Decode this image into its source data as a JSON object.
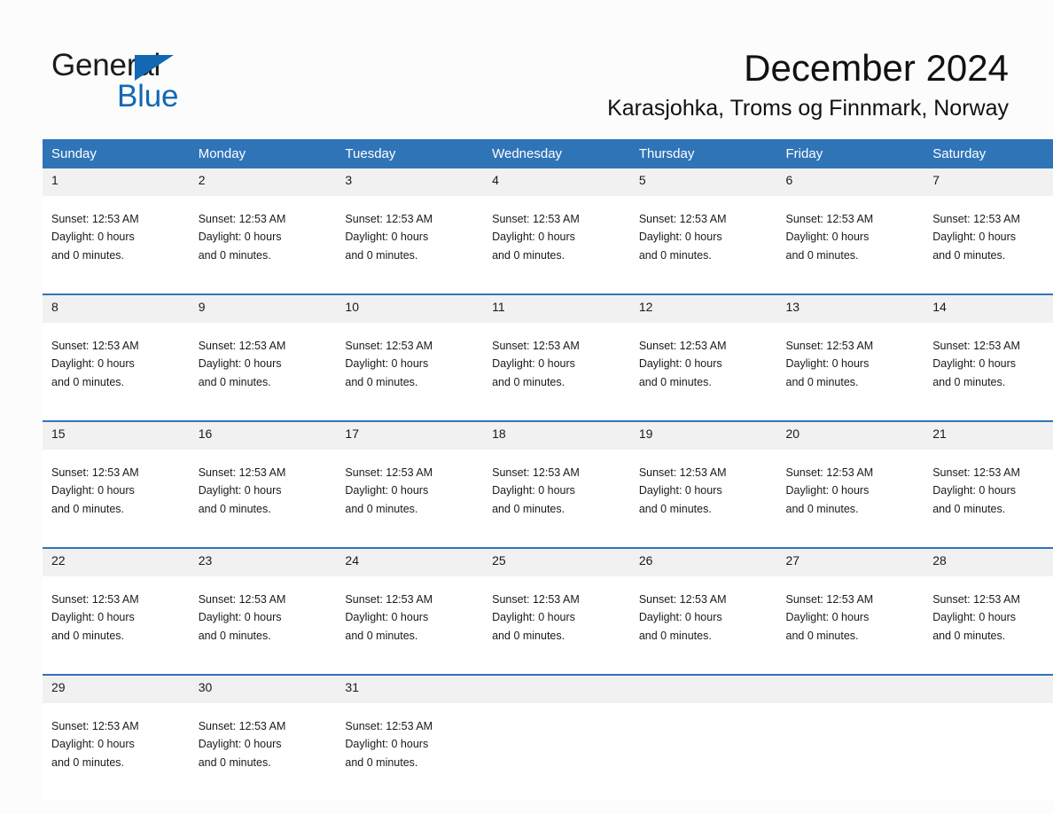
{
  "brand": {
    "name_part1": "General",
    "name_part2": "Blue",
    "triangle_icon": "triangle-icon",
    "colors": {
      "blue": "#1268b3",
      "black": "#1b1b1b"
    }
  },
  "header": {
    "month_title": "December 2024",
    "location": "Karasjohka, Troms og Finnmark, Norway"
  },
  "theme": {
    "header_blue": "#3074b8",
    "daynum_band": "#f1f1f1",
    "page_background": "#fcfcfc",
    "text": "#1a1a1a"
  },
  "calendar": {
    "weekday_headers": [
      "Sunday",
      "Monday",
      "Tuesday",
      "Wednesday",
      "Thursday",
      "Friday",
      "Saturday"
    ],
    "weeks": [
      {
        "days": [
          {
            "date": "1",
            "sunset": "Sunset: 12:53 AM",
            "daylight": "Daylight: 0 hours",
            "minutes": "and 0 minutes."
          },
          {
            "date": "2",
            "sunset": "Sunset: 12:53 AM",
            "daylight": "Daylight: 0 hours",
            "minutes": "and 0 minutes."
          },
          {
            "date": "3",
            "sunset": "Sunset: 12:53 AM",
            "daylight": "Daylight: 0 hours",
            "minutes": "and 0 minutes."
          },
          {
            "date": "4",
            "sunset": "Sunset: 12:53 AM",
            "daylight": "Daylight: 0 hours",
            "minutes": "and 0 minutes."
          },
          {
            "date": "5",
            "sunset": "Sunset: 12:53 AM",
            "daylight": "Daylight: 0 hours",
            "minutes": "and 0 minutes."
          },
          {
            "date": "6",
            "sunset": "Sunset: 12:53 AM",
            "daylight": "Daylight: 0 hours",
            "minutes": "and 0 minutes."
          },
          {
            "date": "7",
            "sunset": "Sunset: 12:53 AM",
            "daylight": "Daylight: 0 hours",
            "minutes": "and 0 minutes."
          }
        ]
      },
      {
        "days": [
          {
            "date": "8",
            "sunset": "Sunset: 12:53 AM",
            "daylight": "Daylight: 0 hours",
            "minutes": "and 0 minutes."
          },
          {
            "date": "9",
            "sunset": "Sunset: 12:53 AM",
            "daylight": "Daylight: 0 hours",
            "minutes": "and 0 minutes."
          },
          {
            "date": "10",
            "sunset": "Sunset: 12:53 AM",
            "daylight": "Daylight: 0 hours",
            "minutes": "and 0 minutes."
          },
          {
            "date": "11",
            "sunset": "Sunset: 12:53 AM",
            "daylight": "Daylight: 0 hours",
            "minutes": "and 0 minutes."
          },
          {
            "date": "12",
            "sunset": "Sunset: 12:53 AM",
            "daylight": "Daylight: 0 hours",
            "minutes": "and 0 minutes."
          },
          {
            "date": "13",
            "sunset": "Sunset: 12:53 AM",
            "daylight": "Daylight: 0 hours",
            "minutes": "and 0 minutes."
          },
          {
            "date": "14",
            "sunset": "Sunset: 12:53 AM",
            "daylight": "Daylight: 0 hours",
            "minutes": "and 0 minutes."
          }
        ]
      },
      {
        "days": [
          {
            "date": "15",
            "sunset": "Sunset: 12:53 AM",
            "daylight": "Daylight: 0 hours",
            "minutes": "and 0 minutes."
          },
          {
            "date": "16",
            "sunset": "Sunset: 12:53 AM",
            "daylight": "Daylight: 0 hours",
            "minutes": "and 0 minutes."
          },
          {
            "date": "17",
            "sunset": "Sunset: 12:53 AM",
            "daylight": "Daylight: 0 hours",
            "minutes": "and 0 minutes."
          },
          {
            "date": "18",
            "sunset": "Sunset: 12:53 AM",
            "daylight": "Daylight: 0 hours",
            "minutes": "and 0 minutes."
          },
          {
            "date": "19",
            "sunset": "Sunset: 12:53 AM",
            "daylight": "Daylight: 0 hours",
            "minutes": "and 0 minutes."
          },
          {
            "date": "20",
            "sunset": "Sunset: 12:53 AM",
            "daylight": "Daylight: 0 hours",
            "minutes": "and 0 minutes."
          },
          {
            "date": "21",
            "sunset": "Sunset: 12:53 AM",
            "daylight": "Daylight: 0 hours",
            "minutes": "and 0 minutes."
          }
        ]
      },
      {
        "days": [
          {
            "date": "22",
            "sunset": "Sunset: 12:53 AM",
            "daylight": "Daylight: 0 hours",
            "minutes": "and 0 minutes."
          },
          {
            "date": "23",
            "sunset": "Sunset: 12:53 AM",
            "daylight": "Daylight: 0 hours",
            "minutes": "and 0 minutes."
          },
          {
            "date": "24",
            "sunset": "Sunset: 12:53 AM",
            "daylight": "Daylight: 0 hours",
            "minutes": "and 0 minutes."
          },
          {
            "date": "25",
            "sunset": "Sunset: 12:53 AM",
            "daylight": "Daylight: 0 hours",
            "minutes": "and 0 minutes."
          },
          {
            "date": "26",
            "sunset": "Sunset: 12:53 AM",
            "daylight": "Daylight: 0 hours",
            "minutes": "and 0 minutes."
          },
          {
            "date": "27",
            "sunset": "Sunset: 12:53 AM",
            "daylight": "Daylight: 0 hours",
            "minutes": "and 0 minutes."
          },
          {
            "date": "28",
            "sunset": "Sunset: 12:53 AM",
            "daylight": "Daylight: 0 hours",
            "minutes": "and 0 minutes."
          }
        ]
      },
      {
        "days": [
          {
            "date": "29",
            "sunset": "Sunset: 12:53 AM",
            "daylight": "Daylight: 0 hours",
            "minutes": "and 0 minutes."
          },
          {
            "date": "30",
            "sunset": "Sunset: 12:53 AM",
            "daylight": "Daylight: 0 hours",
            "minutes": "and 0 minutes."
          },
          {
            "date": "31",
            "sunset": "Sunset: 12:53 AM",
            "daylight": "Daylight: 0 hours",
            "minutes": "and 0 minutes."
          },
          {
            "date": "",
            "sunset": "",
            "daylight": "",
            "minutes": ""
          },
          {
            "date": "",
            "sunset": "",
            "daylight": "",
            "minutes": ""
          },
          {
            "date": "",
            "sunset": "",
            "daylight": "",
            "minutes": ""
          },
          {
            "date": "",
            "sunset": "",
            "daylight": "",
            "minutes": ""
          }
        ]
      }
    ]
  }
}
